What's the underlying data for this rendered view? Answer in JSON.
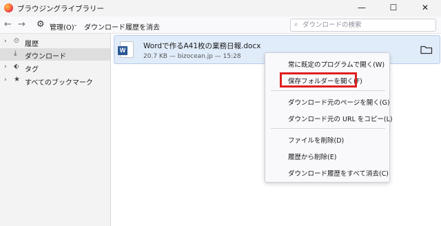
{
  "window": {
    "title": "ブラウジングライブラリー",
    "minimize_glyph": "—",
    "maximize_glyph": "☐",
    "close_glyph": "✕"
  },
  "toolbar": {
    "back_glyph": "←",
    "forward_glyph": "→",
    "gear_glyph": "⚙",
    "manage_label": "管理(O)",
    "manage_arrow": "⌄",
    "clear_label": "ダウンロード履歴を消去",
    "search_placeholder": "ダウンロードの検索",
    "search_icon_glyph": "⌕"
  },
  "sidebar": {
    "items": [
      {
        "label": "履歴",
        "twisty": "›",
        "icon": "⏲"
      },
      {
        "label": "ダウンロード",
        "twisty": "",
        "icon": "⤓"
      },
      {
        "label": "タグ",
        "twisty": "›",
        "icon": "⬖"
      },
      {
        "label": "すべてのブックマーク",
        "twisty": "›",
        "icon": "★"
      }
    ]
  },
  "download": {
    "file_name": "Wordで作るA41枚の業務日報.docx",
    "meta": "20.7 KB — bizocean.jp — 15:28",
    "icon_letter": "W"
  },
  "context_menu": {
    "items": [
      {
        "label": "常に既定のプログラムで開く(W)"
      },
      {
        "label": "保存フォルダーを開く(F)"
      },
      {
        "label": "ダウンロード元のページを開く(G)"
      },
      {
        "label": "ダウンロード元の URL をコピー(L)"
      },
      {
        "label": "ファイルを削除(D)"
      },
      {
        "label": "履歴から削除(E)"
      },
      {
        "label": "ダウンロード履歴をすべて消去(C)"
      }
    ]
  },
  "colors": {
    "highlight_border": "#e01e1e",
    "selected_row": "#e1ecfa",
    "word_blue": "#2b5797"
  }
}
